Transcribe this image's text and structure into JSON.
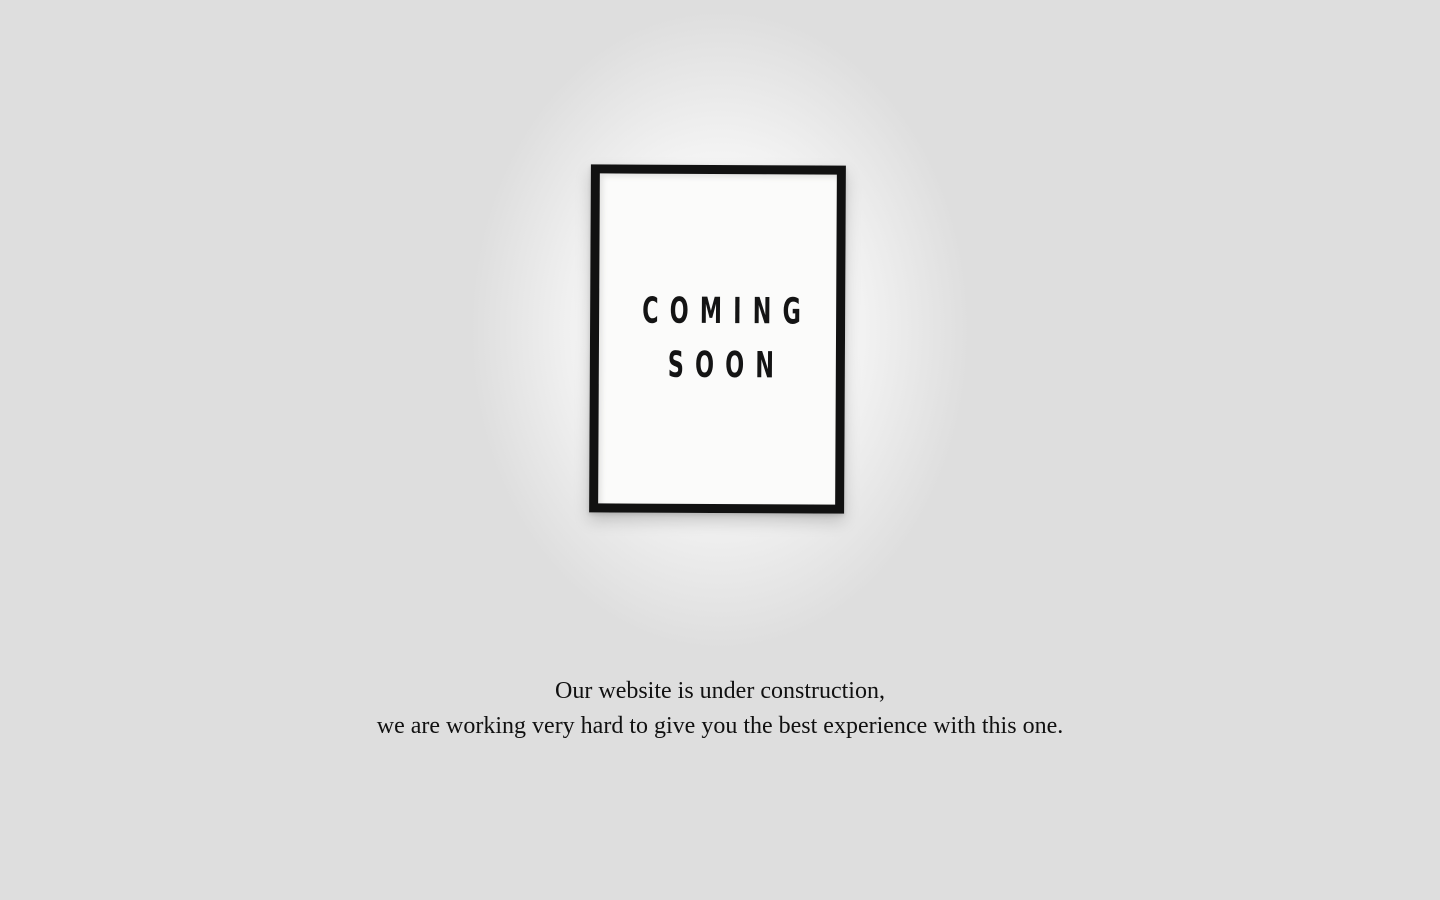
{
  "poster": {
    "line1": "COMING",
    "line2": "SOON"
  },
  "message": {
    "line1": "Our website is under construction,",
    "line2": "we are working very hard to give you the best experience with this one."
  },
  "colors": {
    "background": "#dedede",
    "frame": "#111111",
    "poster": "#fbfbfa",
    "text": "#111111"
  }
}
